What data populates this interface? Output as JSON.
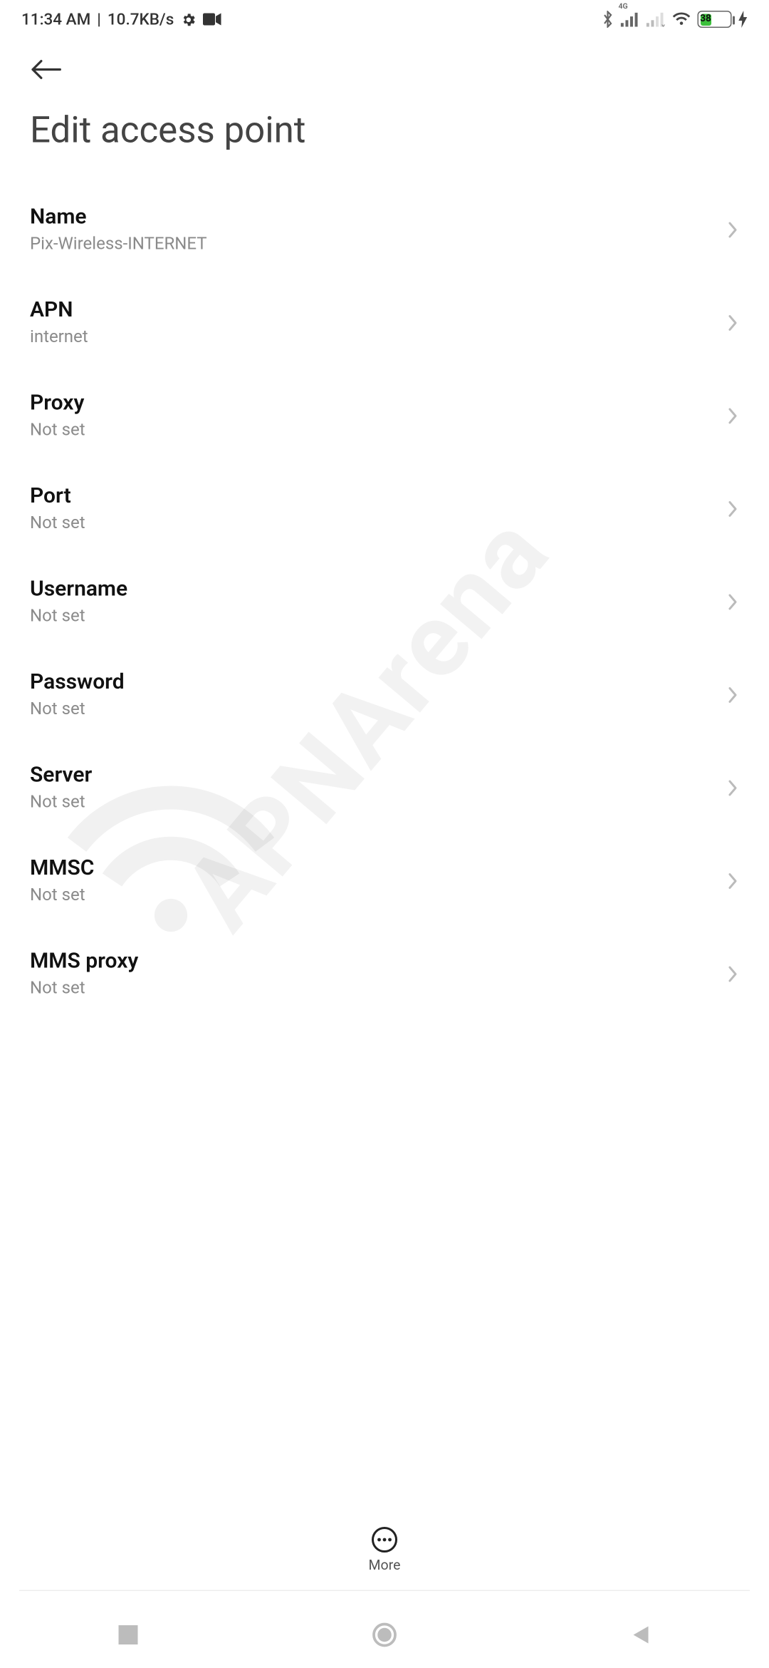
{
  "status": {
    "time": "11:34 AM",
    "speed": "10.7KB/s",
    "network_badge": "4G",
    "battery_percent": "38"
  },
  "header": {
    "title": "Edit access point"
  },
  "rows": [
    {
      "label": "Name",
      "value": "Pix-Wireless-INTERNET"
    },
    {
      "label": "APN",
      "value": "internet"
    },
    {
      "label": "Proxy",
      "value": "Not set"
    },
    {
      "label": "Port",
      "value": "Not set"
    },
    {
      "label": "Username",
      "value": "Not set"
    },
    {
      "label": "Password",
      "value": "Not set"
    },
    {
      "label": "Server",
      "value": "Not set"
    },
    {
      "label": "MMSC",
      "value": "Not set"
    },
    {
      "label": "MMS proxy",
      "value": "Not set"
    }
  ],
  "bottom": {
    "more_label": "More"
  },
  "watermark": {
    "text": "APNArena"
  }
}
